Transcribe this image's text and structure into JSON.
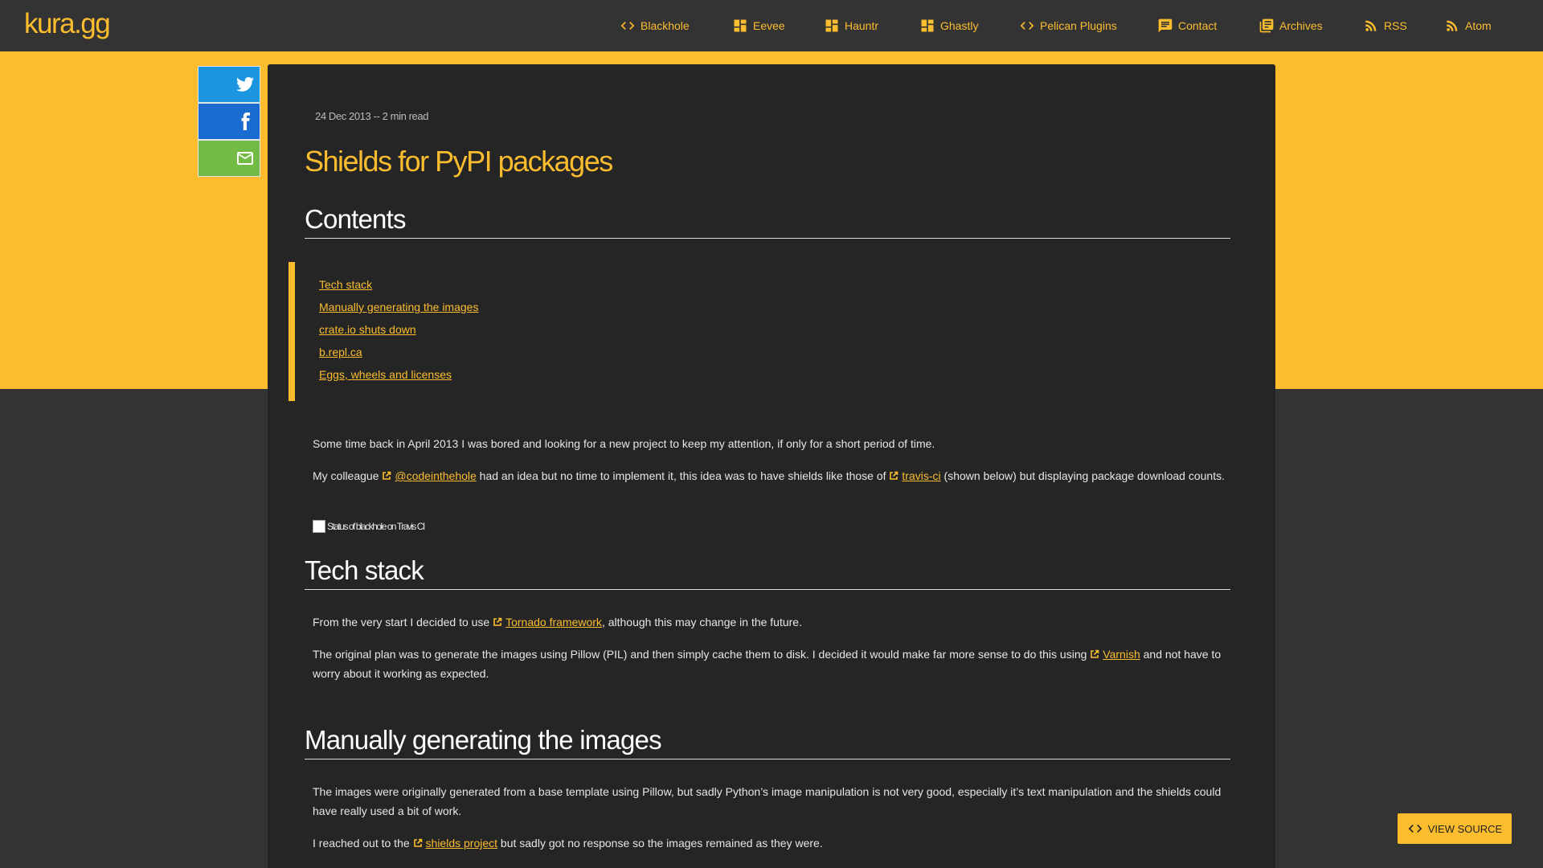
{
  "brand": "kura.gg",
  "nav": [
    {
      "label": "Blackhole",
      "icon": "code-icon"
    },
    {
      "label": "Eevee",
      "icon": "dashboard-icon"
    },
    {
      "label": "Hauntr",
      "icon": "dashboard-icon"
    },
    {
      "label": "Ghastly",
      "icon": "dashboard-icon"
    },
    {
      "label": "Pelican Plugins",
      "icon": "code-icon"
    },
    {
      "label": "Contact",
      "icon": "chat-icon"
    },
    {
      "label": "Archives",
      "icon": "archive-icon"
    },
    {
      "label": "RSS",
      "icon": "rss-icon"
    },
    {
      "label": "Atom",
      "icon": "rss-icon"
    }
  ],
  "share": [
    "twitter-icon",
    "facebook-icon",
    "email-icon"
  ],
  "article": {
    "meta": "24 Dec 2013 -- 2 min read",
    "title": "Shields for PyPI packages",
    "contents_heading": "Contents",
    "toc": [
      "Tech stack",
      "Manually generating the images",
      "crate.io shuts down",
      "b.repl.ca",
      "Eggs, wheels and licenses"
    ],
    "p1": "Some time back in April 2013 I was bored and looking for a new project to keep my attention, if only for a short period of time.",
    "p2_a": "My colleague ",
    "p2_link1": "@codeinthehole",
    "p2_b": " had an idea but no time to implement it, this idea was to have shields like those of ",
    "p2_link2": "travis-ci",
    "p2_c": " (shown below) but displaying package download counts.",
    "badge_alt": "Status of blackhole on Travis CI",
    "tech_heading": "Tech stack",
    "p3_a": "From the very start I decided to use ",
    "p3_link": "Tornado framework",
    "p3_b": ", although this may change in the future.",
    "p4_a": "The original plan was to generate the images using Pillow (PIL) and then simply cache them to disk. I decided it would make far more sense to do this using ",
    "p4_link": "Varnish",
    "p4_b": " and not have to worry about it working as expected.",
    "manual_heading": "Manually generating the images",
    "p5": "The images were originally generated from a base template using Pillow, but sadly Python’s image manipulation is not very good, especially it’s text manipulation and the shields could have really used a bit of work.",
    "p6_a": "I reached out to the ",
    "p6_link": "shields project",
    "p6_b": " but sadly got no response so the images remained as they were."
  },
  "view_source": "VIEW SOURCE",
  "colors": {
    "accent": "#fbbd2e",
    "background": "#333333",
    "card": "#252525"
  }
}
